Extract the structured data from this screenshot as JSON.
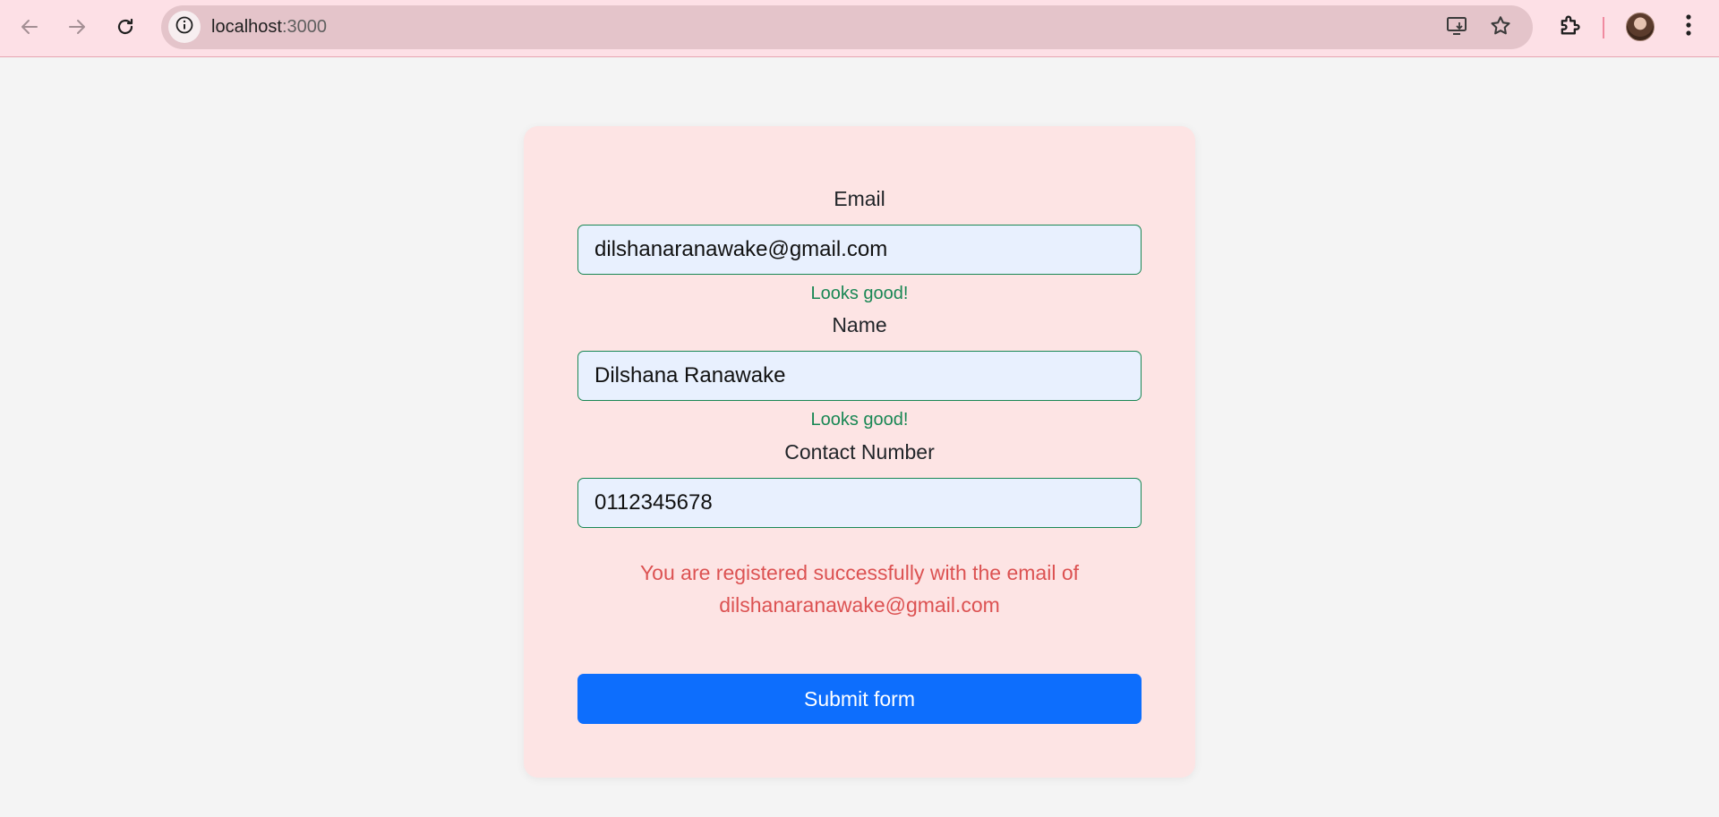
{
  "browser": {
    "url_host": "localhost",
    "url_port": ":3000",
    "icons": [
      "back-arrow-icon",
      "forward-arrow-icon",
      "reload-icon",
      "site-info-icon",
      "install-app-icon",
      "bookmark-star-icon",
      "extensions-puzzle-icon",
      "profile-avatar",
      "kebab-menu-icon"
    ],
    "theme_color": "#fde0e6"
  },
  "form": {
    "email": {
      "label": "Email",
      "value": "dilshanaranawake@gmail.com",
      "feedback": "Looks good!"
    },
    "name": {
      "label": "Name",
      "value": "Dilshana Ranawake",
      "feedback": "Looks good!"
    },
    "contact": {
      "label": "Contact Number",
      "value": "0112345678"
    },
    "message_line1": "You are registered successfully with the email of",
    "message_line2": "dilshanaranawake@gmail.com",
    "submit_label": "Submit form",
    "colors": {
      "card_bg": "#fde4e4",
      "valid": "#198754",
      "message": "#dc5252",
      "button": "#0d6efd"
    }
  }
}
